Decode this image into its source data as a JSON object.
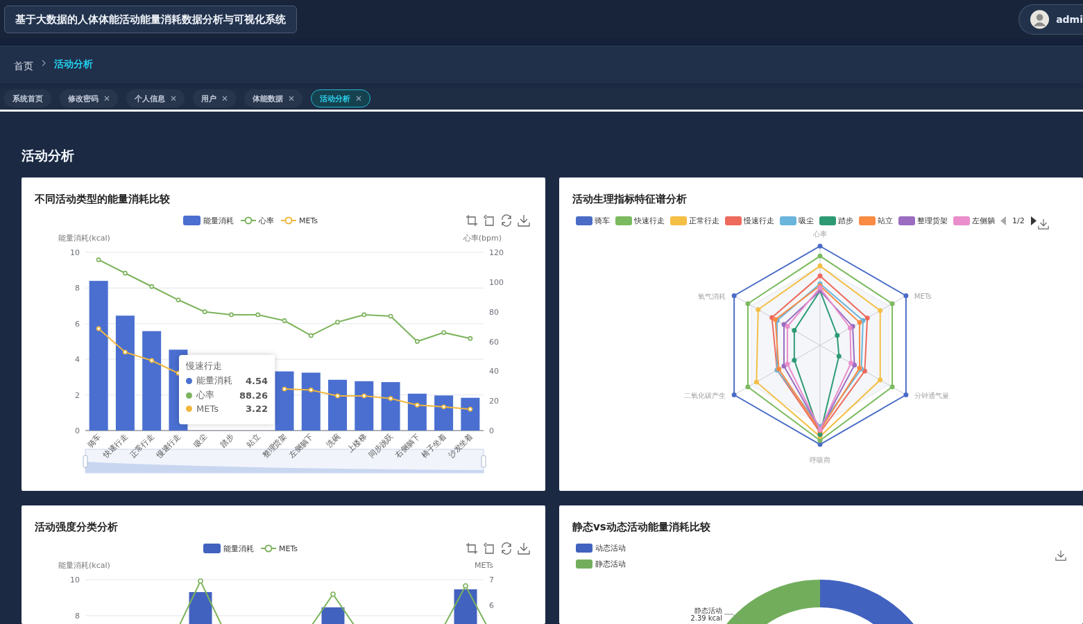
{
  "header": {
    "title": "基于大数据的人体体能活动能量消耗数据分析与可视化系统",
    "user": "admi"
  },
  "breadcrumb": [
    {
      "label": "首页",
      "current": false
    },
    {
      "label": "活动分析",
      "current": true
    }
  ],
  "tabs": [
    {
      "label": "系统首页",
      "selected": false,
      "closable": false
    },
    {
      "label": "修改密码",
      "selected": false,
      "closable": true
    },
    {
      "label": "个人信息",
      "selected": false,
      "closable": true
    },
    {
      "label": "用户",
      "selected": false,
      "closable": true
    },
    {
      "label": "体能数据",
      "selected": false,
      "closable": true
    },
    {
      "label": "活动分析",
      "selected": true,
      "closable": true
    }
  ],
  "page_title": "活动分析",
  "energy_card": {
    "title": "不同活动类型的能量消耗比较",
    "chart_data": {
      "type": "bar",
      "ylabel": "能量消耗(kcal)",
      "yticks": [
        0,
        2,
        4,
        6,
        8,
        10
      ],
      "ylim": [
        0,
        10
      ],
      "grid": true,
      "categories": [
        "骑车",
        "快速行走",
        "正常行走",
        "慢速行走",
        "吸尘",
        "踏步",
        "站立",
        "整理货架",
        "左侧躺下",
        "洗碗",
        "上楼梯",
        "同步跳跃",
        "右侧躺下",
        "椅子坐着",
        "沙发坐着"
      ],
      "series": [
        {
          "name": "能量消耗",
          "type": "bar",
          "color": "#4a6fd0",
          "values": [
            8.4,
            6.45,
            5.58,
            4.54,
            null,
            null,
            null,
            3.32,
            3.25,
            2.85,
            2.77,
            2.72,
            2.07,
            1.97,
            1.84
          ]
        },
        {
          "name": "METs",
          "type": "line",
          "marker": true,
          "color": "#f0b63d",
          "values": [
            5.72,
            4.4,
            3.93,
            3.22,
            null,
            null,
            null,
            2.33,
            2.28,
            1.95,
            1.95,
            1.8,
            1.43,
            1.33,
            1.2
          ]
        }
      ]
    },
    "heart_rate_chart": {
      "chart_data": {
        "type": "line",
        "ylabel": "心率(bpm)",
        "yticks": [
          0,
          20,
          40,
          60,
          80,
          100,
          120
        ],
        "ylim": [
          0,
          120
        ],
        "series": [
          {
            "name": "心率",
            "type": "line",
            "marker": true,
            "color": "#7cb35c",
            "values": [
              115,
              106,
              97,
              88,
              80,
              78,
              78,
              74,
              64,
              73,
              78,
              77,
              60,
              66,
              62
            ]
          }
        ]
      }
    },
    "tooltip": {
      "title": "慢速行走",
      "rows": [
        {
          "name": "能量消耗",
          "value": "4.54",
          "color": "#4a6fd0"
        },
        {
          "name": "心率",
          "value": "88.26",
          "color": "#7cb35c"
        },
        {
          "name": "METs",
          "value": "3.22",
          "color": "#f0b63d"
        }
      ]
    }
  },
  "radar_card": {
    "title": "活动生理指标特征谱分析",
    "legend": [
      {
        "label": "骑车",
        "color": "#4a6cc7"
      },
      {
        "label": "快速行走",
        "color": "#7cba5f"
      },
      {
        "label": "正常行走",
        "color": "#f4bf45"
      },
      {
        "label": "慢速行走",
        "color": "#ee6a5c"
      },
      {
        "label": "吸尘",
        "color": "#6bb5dc"
      },
      {
        "label": "踏步",
        "color": "#2e9a73"
      },
      {
        "label": "站立",
        "color": "#fa8b43"
      },
      {
        "label": "整理货架",
        "color": "#9b6cc0"
      },
      {
        "label": "左侧躺",
        "color": "#ea8dcb"
      }
    ],
    "pager": "1/2",
    "axes": [
      "心率",
      "氧气消耗",
      "METs",
      "二氧化碳产生",
      "分钟通气量",
      "呼吸商"
    ]
  },
  "intensity_card": {
    "title": "活动强度分类分析",
    "legend": [
      {
        "label": "能量消耗",
        "kind": "bar",
        "color": "#4262bf"
      },
      {
        "label": "METs",
        "kind": "line",
        "color": "#7cb35c"
      }
    ],
    "left_axis": {
      "label": "能量消耗(kcal)",
      "ticks": [
        "10",
        "8"
      ]
    },
    "right_axis": {
      "label": "METs",
      "ticks": [
        "7",
        "6"
      ]
    }
  },
  "donut_card": {
    "title": "静态vs动态活动能量消耗比较",
    "legend": [
      {
        "label": "动态活动",
        "color": "#4262bf"
      },
      {
        "label": "静态活动",
        "color": "#72ad5c"
      }
    ],
    "labels": [
      {
        "name": "静态活动",
        "value": "2.39 kcal"
      }
    ]
  }
}
